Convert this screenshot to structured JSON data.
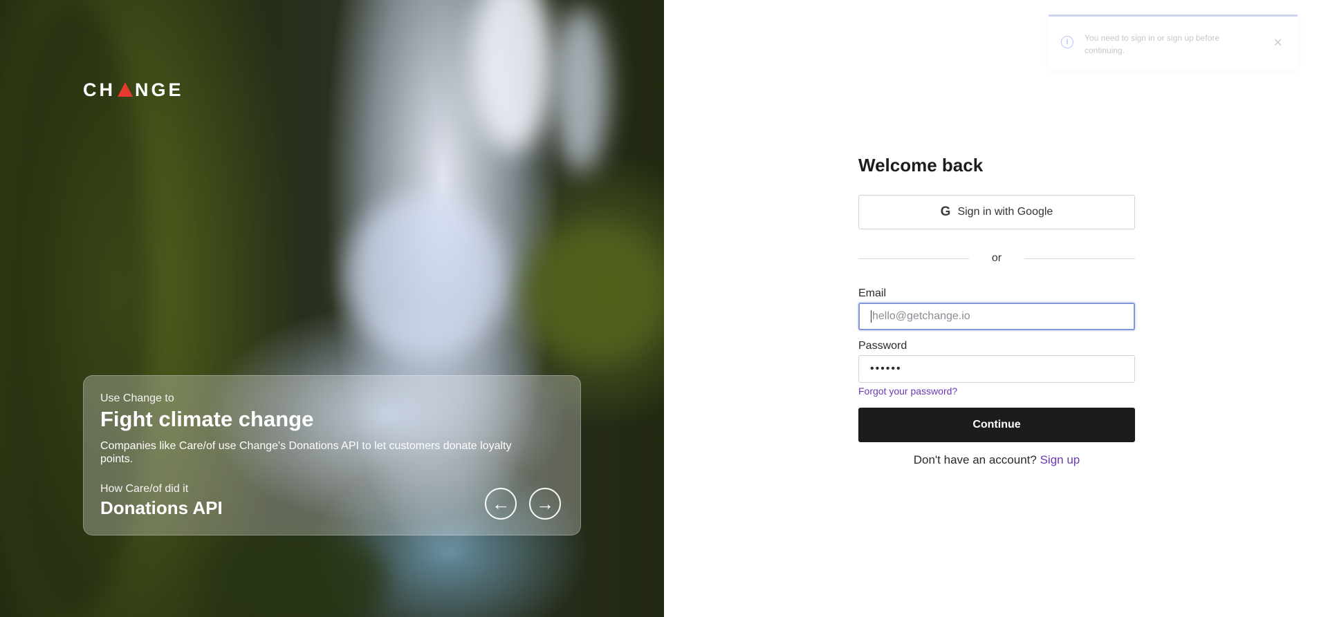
{
  "brand": {
    "logo_text_left": "CH",
    "logo_text_right": "NGE",
    "accent_color": "#e63a2e"
  },
  "hero_card": {
    "eyebrow": "Use Change to",
    "headline": "Fight climate change",
    "description": "Companies like Care/of use Change's Donations API to let customers donate loyalty points.",
    "case_eyebrow": "How Care/of did it",
    "case_title": "Donations API",
    "prev_icon": "arrow-left-icon",
    "next_icon": "arrow-right-icon"
  },
  "toast": {
    "message": "You need to sign in or sign up before continuing.",
    "icon": "info-icon",
    "close_icon": "close-icon"
  },
  "form": {
    "title": "Welcome back",
    "google_label": "Sign in with Google",
    "divider_text": "or",
    "email_label": "Email",
    "email_placeholder": "hello@getchange.io",
    "password_label": "Password",
    "password_value": "••••••",
    "forgot_label": "Forgot your password?",
    "continue_label": "Continue",
    "signup_prompt": "Don't have an account?",
    "signup_link": "Sign up"
  },
  "colors": {
    "primary_button": "#1c1c1c",
    "link": "#6a38b8",
    "focus_border": "#7e94dc"
  }
}
